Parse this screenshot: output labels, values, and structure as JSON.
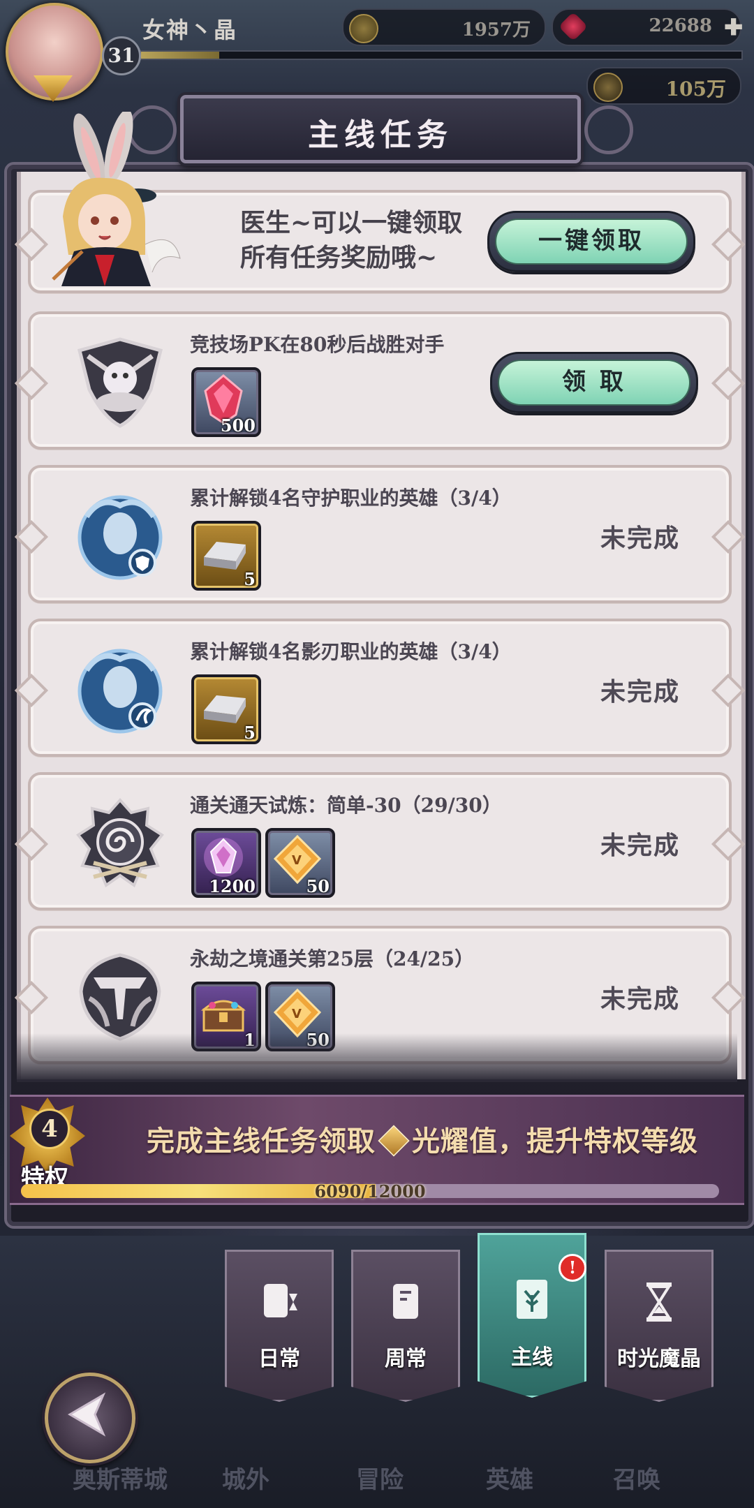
{
  "player": {
    "level": "31",
    "name": "女神丶晶"
  },
  "currencies": {
    "gold": "1957万",
    "gems": "22688",
    "essence": "105万"
  },
  "panel": {
    "title": "主线任务",
    "intro_line1": "医生~可以一键领取",
    "intro_line2": "所有任务奖励哦~",
    "claim_all_label": "一键领取"
  },
  "quests": [
    {
      "title": "竞技场PK在80秒后战胜对手",
      "action_label": "领  取",
      "rewards": [
        {
          "type": "gem",
          "qty": "500"
        }
      ]
    },
    {
      "title": "累计解锁4名守护职业的英雄（3/4）",
      "status": "未完成",
      "rewards": [
        {
          "type": "silver-ingot",
          "qty": "5"
        }
      ]
    },
    {
      "title": "累计解锁4名影刃职业的英雄（3/4）",
      "status": "未完成",
      "rewards": [
        {
          "type": "silver-ingot",
          "qty": "5"
        }
      ]
    },
    {
      "title": "通关通天试炼：简单-30（29/30）",
      "status": "未完成",
      "rewards": [
        {
          "type": "purple-crystal",
          "qty": "1200"
        },
        {
          "type": "orange-diamond",
          "qty": "50"
        }
      ]
    },
    {
      "title": "永劫之境通关第25层（24/25）",
      "status": "未完成",
      "rewards": [
        {
          "type": "treasure-chest",
          "qty": "1"
        },
        {
          "type": "orange-diamond",
          "qty": "50"
        }
      ]
    }
  ],
  "privilege": {
    "level": "4",
    "label": "特权",
    "message_part1": "完成主线任务领取",
    "message_part2": "光耀值，提升特权等级",
    "progress_text": "6090/12000",
    "progress_fraction": 0.5075
  },
  "tabs": [
    {
      "label": "日常",
      "active": false
    },
    {
      "label": "周常",
      "active": false
    },
    {
      "label": "主线",
      "active": true,
      "alert": "!"
    },
    {
      "label": "时光魔晶",
      "active": false
    }
  ],
  "bottom_nav": [
    "奥斯蒂城",
    "城外",
    "冒险",
    "英雄",
    "召唤"
  ],
  "colors": {
    "accent_teal": "#7fd3b4",
    "paper": "#e7e0e2",
    "frame": "#2b2a38",
    "alert": "#e02c28"
  }
}
